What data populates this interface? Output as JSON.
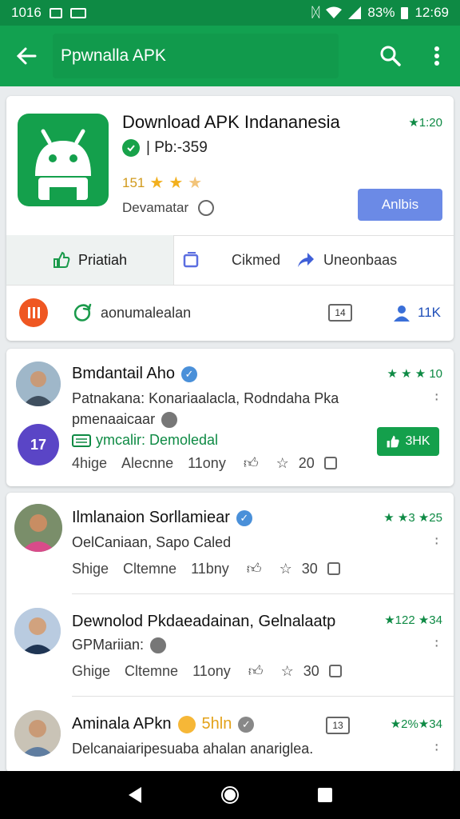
{
  "status": {
    "time": "1016",
    "battery": "83%",
    "clock": "12:69"
  },
  "appbar": {
    "title": "Ppwnalla APK"
  },
  "app": {
    "title": "Download APK Indananesia",
    "rating": "★1:20",
    "developer": "| Pb:-359",
    "stars_label": "151",
    "meta": "Devamatar",
    "primary_button": "Anlbis"
  },
  "tabs": [
    {
      "label": "Priatiah"
    },
    {
      "label": "Cikmed"
    },
    {
      "label": "Uneonbaas"
    }
  ],
  "info": {
    "name": "aonumalealan",
    "box": "14",
    "users": "11K"
  },
  "post": {
    "name": "Bmdantail Aho",
    "rating": "★ ★ ★ 10",
    "line1": "Patnakana: Konariaalacla, Rodndaha Pka",
    "line2": "pmenaaicaar",
    "avatar_text": "17",
    "link": "ymcalir: Demoledal",
    "button": "3HK",
    "actions": {
      "a": "4hige",
      "b": "Alecnne",
      "c": "11ony",
      "d": "20"
    }
  },
  "comments": [
    {
      "name": "Ilmlanaion Sorllamiear",
      "rating": "★ ★3 ★25",
      "line1": "OelCaniaan, Sapo Caled",
      "actions": {
        "a": "Shige",
        "b": "Cltemne",
        "c": "11bny",
        "d": "30"
      }
    },
    {
      "name": "Dewnolod Pkdaeadainan, Gelnalaatp",
      "rating": "★122 ★34",
      "line1": "GPMariian:",
      "actions": {
        "a": "Ghige",
        "b": "Cltemne",
        "c": "11ony",
        "d": "30"
      }
    },
    {
      "name": "Aminala APkn",
      "tag": "5hln",
      "rating": "★2%★34",
      "box": "13",
      "line1": "Delcanaiaripesuaba ahalan anariglea."
    }
  ]
}
